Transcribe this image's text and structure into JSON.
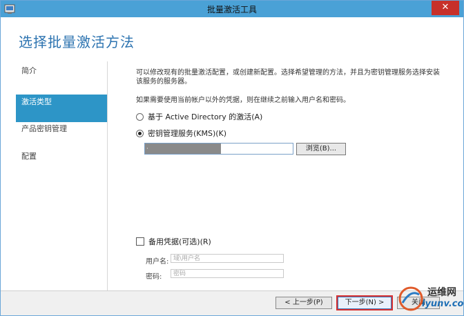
{
  "window": {
    "title": "批量激活工具",
    "close_label": "✕"
  },
  "heading": {
    "text": "选择批量激活方法"
  },
  "nav": {
    "items": [
      {
        "label": "简介"
      },
      {
        "label": "激活类型"
      },
      {
        "label": "产品密钥管理"
      },
      {
        "label": "配置"
      }
    ],
    "active_index": 1
  },
  "main": {
    "description": "可以修改现有的批量激活配置，或创建新配置。选择希望管理的方法，并且为密钥管理服务选择安装该服务的服务器。",
    "credentials_hint": "如果需要使用当前帐户以外的凭据，则在继续之前输入用户名和密码。",
    "option_ad": "基于 Active Directory 的激活(A)",
    "option_kms": "密钥管理服务(KMS)(K)",
    "selected_option": "kms",
    "kms_server_value": "·",
    "browse_label": "浏览(B)...",
    "alt_credentials_label": "备用凭据(可选)(R)",
    "alt_credentials_checked": false,
    "username_label": "用户名:",
    "username_placeholder": "域\\用户名",
    "password_label": "密码:",
    "password_placeholder": "密码"
  },
  "footer": {
    "prev_label": "< 上一步(P)",
    "next_label": "下一步(N) >",
    "close_label": "关闭"
  },
  "watermark": {
    "line1": "运维网",
    "line2": "iyunv.com"
  },
  "colors": {
    "titlebar": "#4aa1d6",
    "heading": "#2c73b0",
    "nav_active": "#2d95c7",
    "close_button": "#c7302a",
    "highlight_outline": "#d83030"
  }
}
